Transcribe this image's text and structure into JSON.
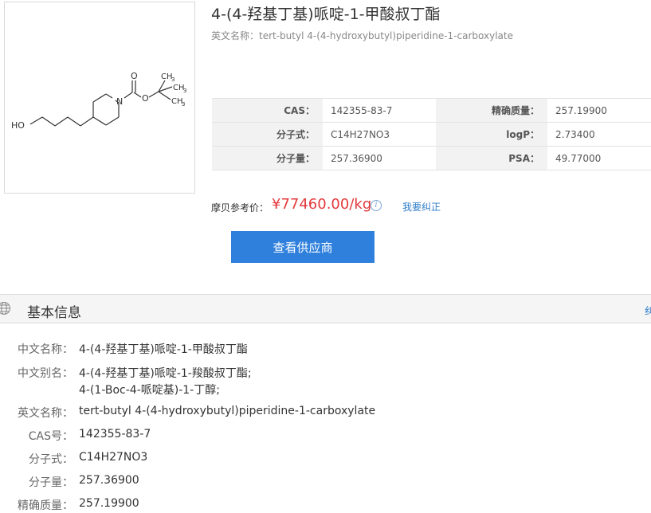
{
  "product": {
    "title": "4-(4-羟基丁基)哌啶-1-甲酸叔丁酯",
    "english_name_line": "英文名称：tert-butyl 4-(4-hydroxybutyl)piperidine-1-carboxylate"
  },
  "structure": {
    "labels": [
      "HO",
      "N",
      "O",
      "O",
      "CH",
      "3",
      "CH",
      "3",
      "CH",
      "3"
    ]
  },
  "props": {
    "rows": [
      {
        "k1": "CAS：",
        "v1": "142355-83-7",
        "k2": "精确质量：",
        "v2": "257.19900"
      },
      {
        "k1": "分子式：",
        "v1": "C14H27NO3",
        "k2": "logP：",
        "v2": "2.73400"
      },
      {
        "k1": "分子量：",
        "v1": "257.36900",
        "k2": "PSA：",
        "v2": "49.77000"
      }
    ]
  },
  "price": {
    "label": "摩贝参考价：",
    "value": "¥77460.00/kg",
    "info_icon_glyph": "i",
    "correct_link": "我要纠正"
  },
  "buttons": {
    "view_suppliers": "查看供应商"
  },
  "section": {
    "title": "基本信息",
    "side_fragment": "纠"
  },
  "basic_info": [
    {
      "label": "中文名称：",
      "values": [
        "4-(4-羟基丁基)哌啶-1-甲酸叔丁酯"
      ]
    },
    {
      "label": "中文别名：",
      "values": [
        "4-(4-羟基丁基)哌啶-1-羧酸叔丁酯;",
        "4-(1-Boc-4-哌啶基)-1-丁醇;"
      ]
    },
    {
      "label": "英文名称：",
      "values": [
        "tert-butyl 4-(4-hydroxybutyl)piperidine-1-carboxylate"
      ]
    },
    {
      "label": "CAS号：",
      "values": [
        "142355-83-7"
      ]
    },
    {
      "label": "分子式：",
      "values": [
        "C14H27NO3"
      ]
    },
    {
      "label": "分子量：",
      "values": [
        "257.36900"
      ]
    },
    {
      "label": "精确质量：",
      "values": [
        "257.19900"
      ]
    }
  ],
  "icons": {
    "info": "info-icon",
    "globe": "globe-icon"
  },
  "colors": {
    "price": "#e4393c",
    "button": "#2f80dd",
    "link": "#2f7dc9"
  }
}
